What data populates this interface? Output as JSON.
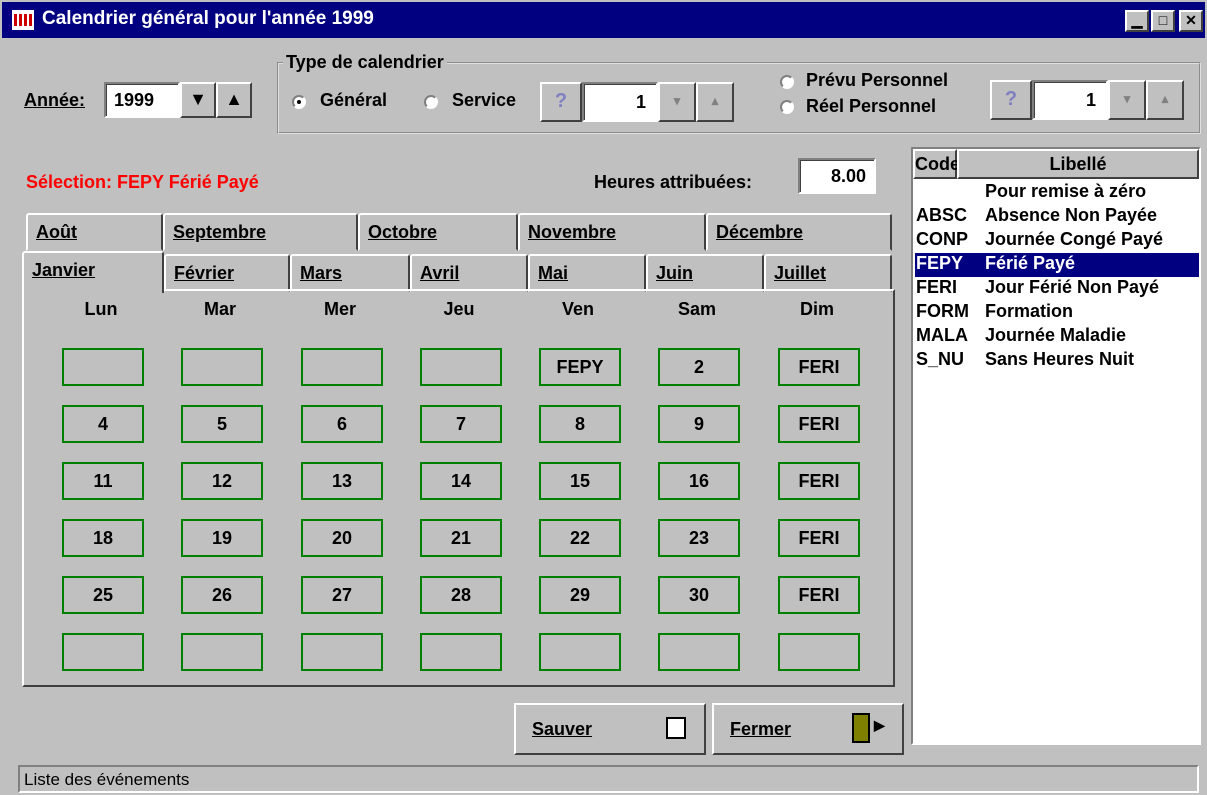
{
  "window": {
    "title": "Calendrier général pour l'année 1999"
  },
  "year": {
    "label": "Année:",
    "value": "1999"
  },
  "type_group": {
    "legend": "Type de calendrier",
    "general_label": "Général",
    "service_label": "Service",
    "service_value": "1",
    "prevu_label": "Prévu Personnel",
    "reel_label": "Réel Personnel",
    "personnel_value": "1",
    "selected": "Général"
  },
  "selection_text": "Sélection: FEPY Férié Payé",
  "hours": {
    "label": "Heures attribuées:",
    "value": "8.00"
  },
  "tabs_back": [
    "Août",
    "Septembre",
    "Octobre",
    "Novembre",
    "Décembre"
  ],
  "tabs_front": [
    "Janvier",
    "Février",
    "Mars",
    "Avril",
    "Mai",
    "Juin",
    "Juillet"
  ],
  "active_tab": "Janvier",
  "weekdays": [
    "Lun",
    "Mar",
    "Mer",
    "Jeu",
    "Ven",
    "Sam",
    "Dim"
  ],
  "calendar_rows": [
    [
      "",
      "",
      "",
      "",
      "FEPY",
      "2",
      "FERI"
    ],
    [
      "4",
      "5",
      "6",
      "7",
      "8",
      "9",
      "FERI"
    ],
    [
      "11",
      "12",
      "13",
      "14",
      "15",
      "16",
      "FERI"
    ],
    [
      "18",
      "19",
      "20",
      "21",
      "22",
      "23",
      "FERI"
    ],
    [
      "25",
      "26",
      "27",
      "28",
      "29",
      "30",
      "FERI"
    ],
    [
      "",
      "",
      "",
      "",
      "",
      "",
      ""
    ]
  ],
  "event_list": {
    "headers": {
      "code": "Code",
      "libelle": "Libellé"
    },
    "rows": [
      {
        "code": "",
        "libelle": "Pour remise à zéro"
      },
      {
        "code": "ABSC",
        "libelle": "Absence Non Payée"
      },
      {
        "code": "CONP",
        "libelle": "Journée Congé Payé"
      },
      {
        "code": "FEPY",
        "libelle": "Férié Payé"
      },
      {
        "code": "FERI",
        "libelle": "Jour Férié Non Payé"
      },
      {
        "code": "FORM",
        "libelle": "Formation"
      },
      {
        "code": "MALA",
        "libelle": "Journée Maladie"
      },
      {
        "code": "S_NU",
        "libelle": "Sans Heures Nuit"
      }
    ],
    "selected_index": 3
  },
  "buttons": {
    "save": "Sauver",
    "close": "Fermer"
  },
  "status": "Liste des événements",
  "colors": {
    "titlebar": "#000080",
    "selection_text": "#ff0000",
    "cell_border": "#008000",
    "selected_row": "#000080"
  }
}
